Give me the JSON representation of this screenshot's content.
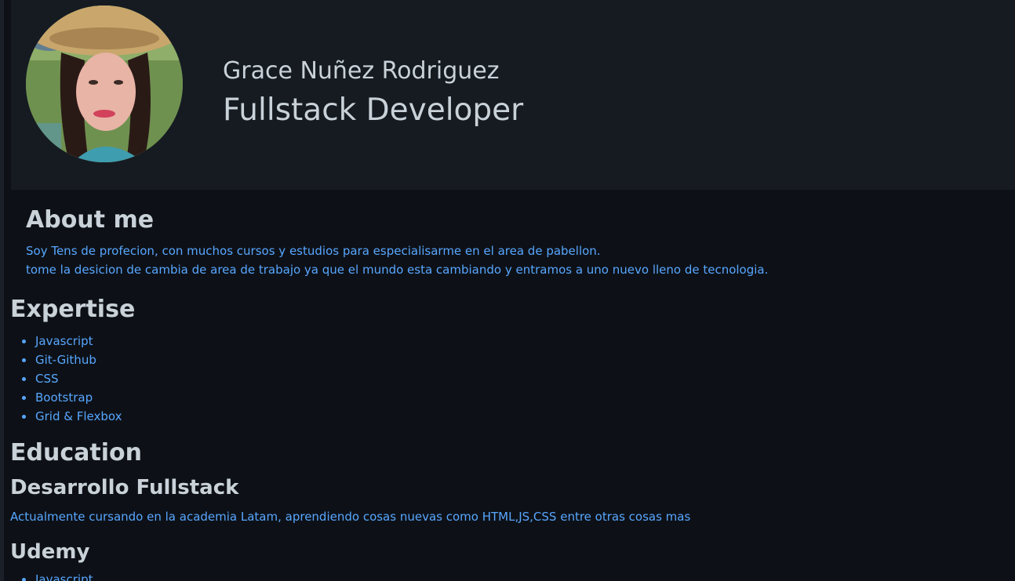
{
  "profile": {
    "name": "Grace Nuñez Rodriguez",
    "role": "Fullstack Developer"
  },
  "about": {
    "title": "About me",
    "line1": "Soy Tens de profecion, con muchos cursos y estudios para especialisarme en el area de pabellon.",
    "line2": "tome la desicion de cambia de area de trabajo ya que el mundo esta cambiando y entramos a uno nuevo lleno de tecnologia."
  },
  "expertise": {
    "title": "Expertise",
    "items": [
      "Javascript",
      "Git-Github",
      "CSS",
      "Bootstrap",
      "Grid & Flexbox"
    ]
  },
  "education": {
    "title": "Education",
    "entries": [
      {
        "title": "Desarrollo Fullstack",
        "description": "Actualmente cursando en la academia Latam, aprendiendo cosas nuevas como HTML,JS,CSS entre otras cosas mas"
      },
      {
        "title": "Udemy",
        "items": [
          "Javascript"
        ]
      }
    ]
  },
  "colors": {
    "background": "#0d1117",
    "header_background": "#161b22",
    "heading_text": "#c9d1d9",
    "body_text": "#58a6ff"
  }
}
